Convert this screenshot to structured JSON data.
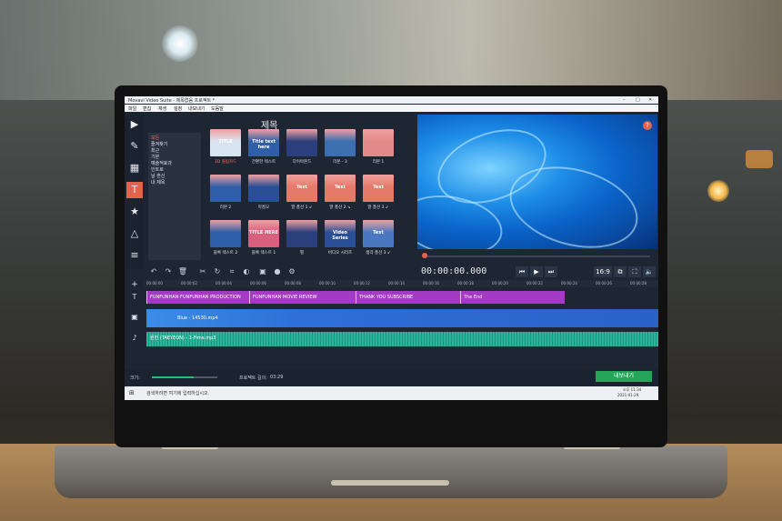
{
  "window": {
    "title": "Movavi Video Suite - 제목없음 프로젝트 *"
  },
  "menu": [
    "파일",
    "편집",
    "재생",
    "설정",
    "내보내기",
    "도움말"
  ],
  "sidebar": {
    "icons": [
      "import-icon",
      "filters-icon",
      "transitions-icon",
      "titles-icon",
      "stickers-icon",
      "shapes-icon",
      "more-icon"
    ]
  },
  "categories": [
    "모든",
    "즐겨찾기",
    "최근",
    "기본",
    "예술적효과",
    "인트로",
    "날 흔신",
    "내 제목"
  ],
  "panel": {
    "title": "제목"
  },
  "tiles": [
    {
      "label": "3D 플립카드",
      "highlight": true
    },
    {
      "label": "간편한 텍스트",
      "highlight": false
    },
    {
      "label": "다이아몬드",
      "highlight": false
    },
    {
      "label": "리본 - 3",
      "highlight": false
    },
    {
      "label": "리본 1",
      "highlight": false
    },
    {
      "label": "리본 2",
      "highlight": false
    },
    {
      "label": "마름모",
      "highlight": false
    },
    {
      "label": "말 풍선 1 ↙",
      "highlight": false
    },
    {
      "label": "말 풍선 2 ↘",
      "highlight": false
    },
    {
      "label": "말 풍선 3 ↙",
      "highlight": false
    },
    {
      "label": "블록 텍스트 2",
      "highlight": false
    },
    {
      "label": "블록 텍스트 1",
      "highlight": false
    },
    {
      "label": "별",
      "highlight": false
    },
    {
      "label": "비디오 시리즈",
      "highlight": false
    },
    {
      "label": "생각 풍선 3 ↙",
      "highlight": false
    }
  ],
  "tile_texts": [
    "TITLE",
    "Title text here",
    "",
    "",
    "",
    "",
    "",
    "Text",
    "Text",
    "Text",
    "",
    "TITLE HERE",
    "",
    "Video Series",
    "Text"
  ],
  "player": {
    "timecode": "00:00:00.000",
    "aspect": "16:9"
  },
  "ruler": [
    "00:00:00",
    "00:00:02",
    "00:00:04",
    "00:00:06",
    "00:00:08",
    "00:00:10",
    "00:00:12",
    "00:00:14",
    "00:00:16",
    "00:00:18",
    "00:00:20",
    "00:00:22",
    "00:00:24",
    "00:00:26",
    "00:00:28"
  ],
  "title_clips": [
    "FUNFUNHAN FUNFUNHAN PRODUCTION",
    "FUNFUNHAN MOVIE REVIEW",
    "THANK YOU SUBSCRIBE",
    "The End"
  ],
  "video_clip": "Blue - 14530.mp4",
  "audio_clip": "원컨 (TAEYEON) - 1-Fime.mp3",
  "bottom": {
    "zoom_label": "크기:",
    "duration_label": "프로젝트 길이:",
    "duration": "03:29",
    "export": "내보내기"
  },
  "taskbar": {
    "search": "검색하려면 여기에 입력하십시오.",
    "time": "오후 11:34",
    "date": "2021-01-29"
  }
}
